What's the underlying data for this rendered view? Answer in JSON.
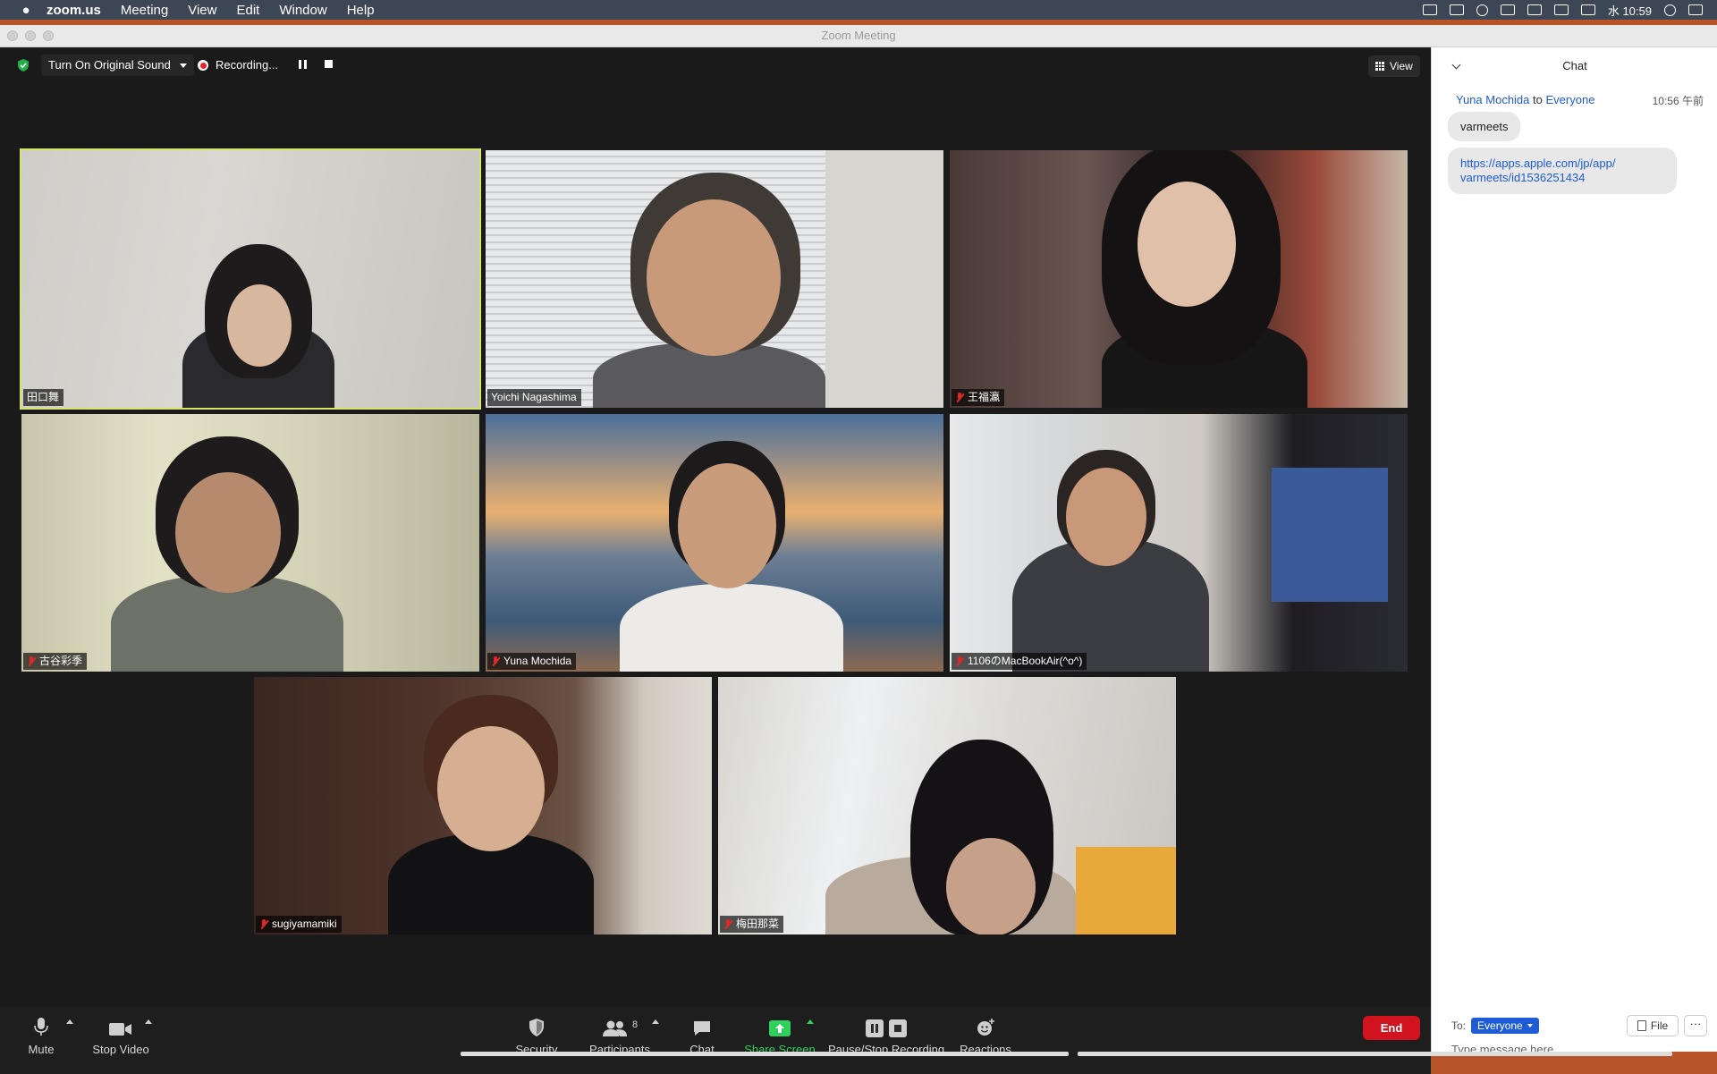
{
  "menubar": {
    "items": [
      "zoom.us",
      "Meeting",
      "View",
      "Edit",
      "Window",
      "Help"
    ],
    "clock": "水 10:59"
  },
  "window": {
    "title": "Zoom Meeting"
  },
  "topbar": {
    "original_sound": "Turn On Original Sound",
    "recording": "Recording...",
    "view": "View"
  },
  "participants": [
    {
      "name": "田口舞",
      "muted": false,
      "active": true
    },
    {
      "name": "Yoichi Nagashima",
      "muted": false,
      "active": false
    },
    {
      "name": "王福瀛",
      "muted": true,
      "active": false
    },
    {
      "name": "古谷彩季",
      "muted": true,
      "active": false
    },
    {
      "name": "Yuna Mochida",
      "muted": true,
      "active": false
    },
    {
      "name": "1106のMacBookAir(^o^)",
      "muted": true,
      "active": false
    },
    {
      "name": "sugiyamamiki",
      "muted": true,
      "active": false
    },
    {
      "name": "梅田那菜",
      "muted": true,
      "active": false
    }
  ],
  "toolbar": {
    "mute": "Mute",
    "stop_video": "Stop Video",
    "security": "Security",
    "participants": "Participants",
    "participants_count": "8",
    "chat": "Chat",
    "share_screen": "Share Screen",
    "pause_stop_recording": "Pause/Stop Recording",
    "reactions": "Reactions",
    "end": "End"
  },
  "chat": {
    "title": "Chat",
    "sender": "Yuna Mochida",
    "to_word": "to",
    "recipient": "Everyone",
    "time": "10:56 午前",
    "messages": [
      "varmeets",
      "https://apps.apple.com/jp/app/varmeets/id1536251434"
    ],
    "link_line1": "https://apps.apple.com/jp/app/",
    "link_line2": "varmeets/id1536251434",
    "to_label": "To:",
    "to_value": "Everyone",
    "file": "File",
    "more": "···",
    "placeholder": "Type message here..."
  },
  "colors": {
    "active_speaker": "#d6e56a",
    "end_button": "#d1121f",
    "share_green": "#2fd15c",
    "link_blue": "#1d5bd8",
    "recording_red": "#e02828"
  }
}
